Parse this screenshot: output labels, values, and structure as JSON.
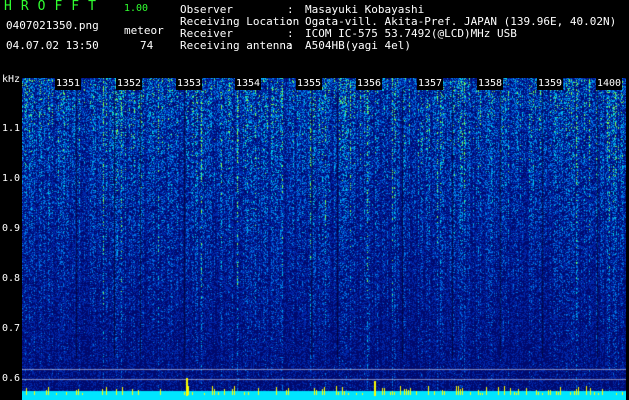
{
  "app": {
    "title": "HROFFT",
    "version": "1.00"
  },
  "file": {
    "name": "0407021350.png",
    "datetime": "04.07.02 13:50"
  },
  "meteor": {
    "label": "meteor",
    "count": "74"
  },
  "info": [
    {
      "label": "Observer",
      "value": "Masayuki Kobayashi"
    },
    {
      "label": "Receiving Location",
      "value": "Ogata-vill. Akita-Pref. JAPAN (139.96E, 40.02N)"
    },
    {
      "label": "Receiver",
      "value": "ICOM IC-575 53.7492(@LCD)MHz USB"
    },
    {
      "label": "Receiving antenna",
      "value": "A504HB(yagi 4el)"
    }
  ],
  "axis": {
    "unit": "kHz",
    "ticks": [
      "1.1",
      "1.0",
      "0.9",
      "0.8",
      "0.7",
      "0.6"
    ]
  },
  "time_labels": [
    "1351",
    "1352",
    "1353",
    "1354",
    "1355",
    "1356",
    "1357",
    "1358",
    "1359",
    "1400"
  ],
  "colors": {
    "background": "#000000",
    "title": "#30ff30",
    "noise_base": "#001a8c",
    "signal_peak": "#ffff00",
    "baseline": "#00e5ff"
  }
}
